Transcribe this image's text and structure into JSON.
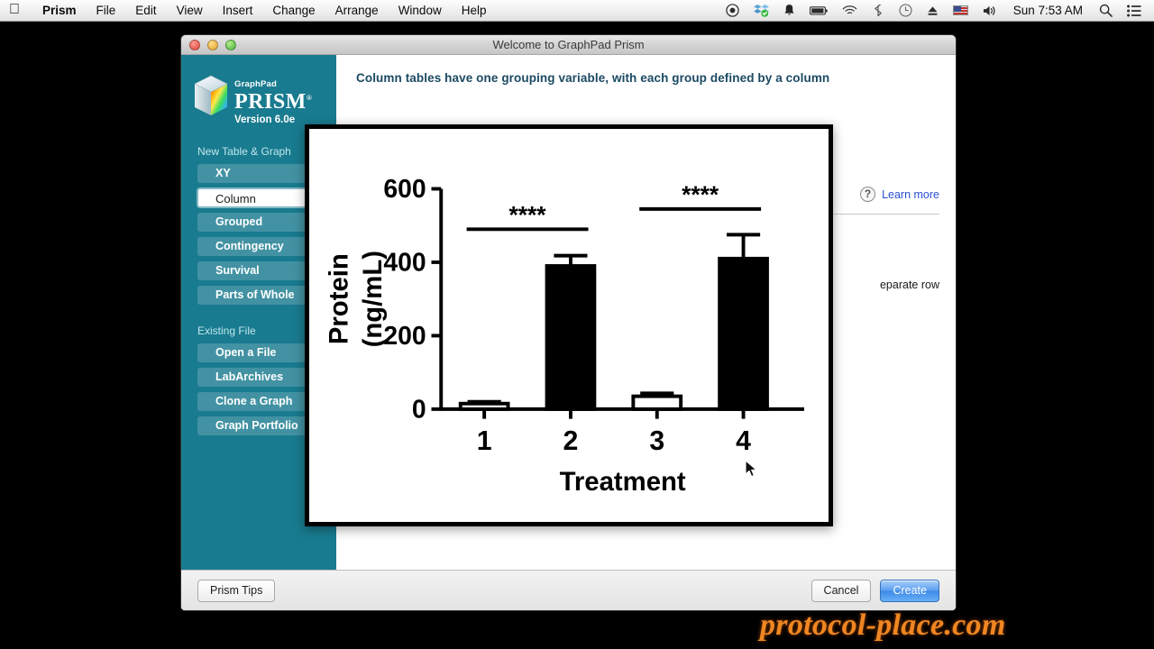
{
  "menubar": {
    "apple_icon": "apple-icon",
    "items": [
      {
        "label": "Prism",
        "bold": true
      },
      {
        "label": "File",
        "bold": false
      },
      {
        "label": "Edit",
        "bold": false
      },
      {
        "label": "View",
        "bold": false
      },
      {
        "label": "Insert",
        "bold": false
      },
      {
        "label": "Change",
        "bold": false
      },
      {
        "label": "Arrange",
        "bold": false
      },
      {
        "label": "Window",
        "bold": false
      },
      {
        "label": "Help",
        "bold": false
      }
    ],
    "status_icons": [
      "record-icon",
      "dropbox-sync-icon",
      "bell-icon",
      "battery-icon",
      "wifi-icon",
      "bluetooth-icon",
      "time-machine-icon",
      "eject-icon",
      "us-flag-icon",
      "volume-icon"
    ],
    "clock": "Sun 7:53 AM",
    "search_icon": "search-icon",
    "notification_center_icon": "notification-center-icon"
  },
  "window": {
    "title": "Welcome to GraphPad Prism",
    "traffic_lights": [
      "close-button",
      "minimize-button",
      "zoom-button"
    ]
  },
  "sidebar": {
    "logo": {
      "brand_small": "GraphPad",
      "brand_main": "PRISM",
      "registered_mark": "®",
      "version": "Version 6.0e"
    },
    "sections": [
      {
        "title": "New Table & Graph",
        "items": [
          {
            "label": "XY",
            "selected": false
          },
          {
            "label": "Column",
            "selected": true
          },
          {
            "label": "Grouped",
            "selected": false
          },
          {
            "label": "Contingency",
            "selected": false
          },
          {
            "label": "Survival",
            "selected": false
          },
          {
            "label": "Parts of Whole",
            "selected": false
          }
        ]
      },
      {
        "title": "Existing File",
        "items": [
          {
            "label": "Open a File",
            "selected": false
          },
          {
            "label": "LabArchives",
            "selected": false
          },
          {
            "label": "Clone a Graph",
            "selected": false
          },
          {
            "label": "Graph Portfolio",
            "selected": false
          }
        ]
      }
    ]
  },
  "main": {
    "heading": "Column tables have one grouping variable, with each group defined by a column",
    "help_icon": "question-mark-icon",
    "learn_more": "Learn more",
    "partial_text": "eparate row"
  },
  "footer": {
    "tips_label": "Prism Tips",
    "cancel_label": "Cancel",
    "create_label": "Create"
  },
  "watermark": "protocol-place.com",
  "colors": {
    "sidebar_teal": "#197b8f",
    "heading_blue": "#1b4a63",
    "link_blue": "#2a4fd6",
    "create_blue": "#3e8ae9",
    "watermark_orange": "#f08622"
  },
  "chart_data": {
    "type": "bar",
    "title": "",
    "xlabel": "Treatment",
    "ylabel": "Protein\n(ng/mL)",
    "ylabel_line1": "Protein",
    "ylabel_line2": "(ng/mL)",
    "categories": [
      "1",
      "2",
      "3",
      "4"
    ],
    "values": [
      15,
      390,
      35,
      410
    ],
    "errors": [
      5,
      28,
      8,
      65
    ],
    "bar_fill": [
      "open",
      "filled",
      "open",
      "filled"
    ],
    "yticks": [
      0,
      200,
      400,
      600
    ],
    "ylim": [
      0,
      600
    ],
    "grid": false,
    "legend": "none",
    "annotations": [
      {
        "text": "****",
        "from": "1",
        "to": "2",
        "y": 490
      },
      {
        "text": "****",
        "from": "3",
        "to": "4",
        "y": 545
      }
    ]
  }
}
